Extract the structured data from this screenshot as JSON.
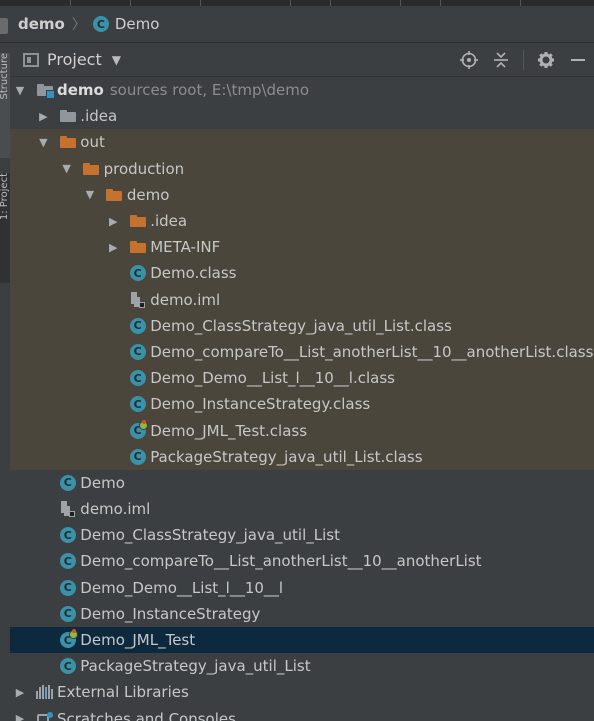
{
  "breadcrumb": {
    "project": "demo",
    "class_name": "Demo"
  },
  "left_tabs": {
    "structure": "Structure",
    "project": "1: Project"
  },
  "panel": {
    "title": "Project"
  },
  "tree": [
    {
      "depth": 0,
      "arrow": "down",
      "icon": "root-folder",
      "name": "demo",
      "suffix": "sources root,  E:\\tmp\\demo",
      "bold": true,
      "hl": false,
      "sel": false
    },
    {
      "depth": 1,
      "arrow": "right",
      "icon": "folder-grey",
      "name": ".idea",
      "hl": false,
      "sel": false
    },
    {
      "depth": 1,
      "arrow": "down",
      "icon": "folder-orange",
      "name": "out",
      "hl": true,
      "sel": false
    },
    {
      "depth": 2,
      "arrow": "down",
      "icon": "folder-orange",
      "name": "production",
      "hl": true,
      "sel": false
    },
    {
      "depth": 3,
      "arrow": "down",
      "icon": "folder-orange",
      "name": "demo",
      "hl": true,
      "sel": false
    },
    {
      "depth": 4,
      "arrow": "right",
      "icon": "folder-orange",
      "name": ".idea",
      "hl": true,
      "sel": false
    },
    {
      "depth": 4,
      "arrow": "right",
      "icon": "folder-orange",
      "name": "META-INF",
      "hl": true,
      "sel": false
    },
    {
      "depth": 4,
      "arrow": "none",
      "icon": "class",
      "name": "Demo.class",
      "hl": true,
      "sel": false
    },
    {
      "depth": 4,
      "arrow": "none",
      "icon": "iml",
      "name": "demo.iml",
      "hl": true,
      "sel": false
    },
    {
      "depth": 4,
      "arrow": "none",
      "icon": "class",
      "name": "Demo_ClassStrategy_java_util_List.class",
      "hl": true,
      "sel": false
    },
    {
      "depth": 4,
      "arrow": "none",
      "icon": "class",
      "name": "Demo_compareTo__List_anotherList__10__anotherList.class",
      "hl": true,
      "sel": false
    },
    {
      "depth": 4,
      "arrow": "none",
      "icon": "class",
      "name": "Demo_Demo__List_l__10__l.class",
      "hl": true,
      "sel": false
    },
    {
      "depth": 4,
      "arrow": "none",
      "icon": "class",
      "name": "Demo_InstanceStrategy.class",
      "hl": true,
      "sel": false
    },
    {
      "depth": 4,
      "arrow": "none",
      "icon": "test-class",
      "name": "Demo_JML_Test.class",
      "hl": true,
      "sel": false
    },
    {
      "depth": 4,
      "arrow": "none",
      "icon": "class",
      "name": "PackageStrategy_java_util_List.class",
      "hl": true,
      "sel": false
    },
    {
      "depth": 1,
      "arrow": "none",
      "icon": "class",
      "name": "Demo",
      "hl": false,
      "sel": false
    },
    {
      "depth": 1,
      "arrow": "none",
      "icon": "iml",
      "name": "demo.iml",
      "hl": false,
      "sel": false
    },
    {
      "depth": 1,
      "arrow": "none",
      "icon": "class",
      "name": "Demo_ClassStrategy_java_util_List",
      "hl": false,
      "sel": false
    },
    {
      "depth": 1,
      "arrow": "none",
      "icon": "class",
      "name": "Demo_compareTo__List_anotherList__10__anotherList",
      "hl": false,
      "sel": false
    },
    {
      "depth": 1,
      "arrow": "none",
      "icon": "class",
      "name": "Demo_Demo__List_l__10__l",
      "hl": false,
      "sel": false
    },
    {
      "depth": 1,
      "arrow": "none",
      "icon": "class",
      "name": "Demo_InstanceStrategy",
      "hl": false,
      "sel": false
    },
    {
      "depth": 1,
      "arrow": "none",
      "icon": "test-class",
      "name": "Demo_JML_Test",
      "hl": false,
      "sel": true
    },
    {
      "depth": 1,
      "arrow": "none",
      "icon": "class",
      "name": "PackageStrategy_java_util_List",
      "hl": false,
      "sel": false
    },
    {
      "depth": 0,
      "arrow": "right",
      "icon": "libraries",
      "name": "External Libraries",
      "hl": false,
      "sel": false
    },
    {
      "depth": 0,
      "arrow": "right",
      "icon": "scratches",
      "name": "Scratches and Consoles",
      "hl": false,
      "sel": false
    }
  ],
  "colors": {
    "background": "#3c3f41",
    "highlight": "#4a463c",
    "selection": "#0d293e",
    "class_icon": "#3a91a8",
    "folder_orange": "#c5722f"
  }
}
